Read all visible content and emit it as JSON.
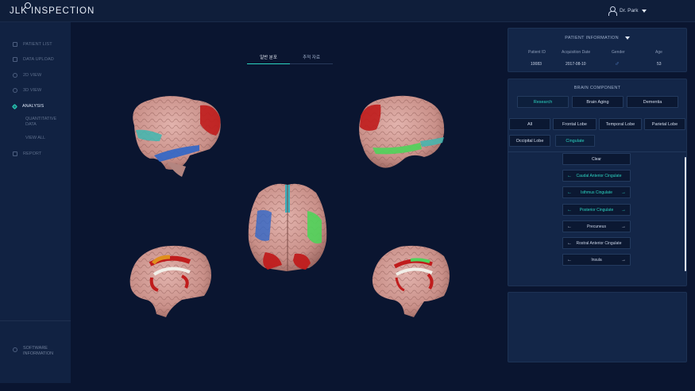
{
  "app": {
    "title": "JLK INSPECTION",
    "user": "Dr. Park"
  },
  "sidebar": {
    "items": [
      {
        "label": "PATIENT LIST"
      },
      {
        "label": "DATA UPLOAD"
      },
      {
        "label": "2D VIEW"
      },
      {
        "label": "3D VIEW"
      },
      {
        "label": "ANALYSIS"
      },
      {
        "label": "QUANTITATIVE"
      },
      {
        "label": "DATA"
      },
      {
        "label": "VIEW ALL"
      },
      {
        "label": "REPORT"
      }
    ],
    "software_line1": "SOFTWARE",
    "software_line2": "INFORMATION"
  },
  "viewer": {
    "tabs": [
      {
        "label": "일반 분포"
      },
      {
        "label": "추적 자료"
      }
    ]
  },
  "patient_info": {
    "title": "PATIENT INFORMATION",
    "headers": {
      "id": "Patient ID",
      "date": "Acquisition Date",
      "gender": "Gender",
      "age": "Age"
    },
    "values": {
      "id": "10083",
      "date": "2017-08-10",
      "gender": "♂",
      "age": "53"
    }
  },
  "brain_component": {
    "title": "BRAIN COMPONENT",
    "categories": [
      {
        "label": "Research"
      },
      {
        "label": "Brain Aging"
      },
      {
        "label": "Dementia"
      }
    ],
    "lobes": [
      {
        "label": "All"
      },
      {
        "label": "Frontal Lobe"
      },
      {
        "label": "Temporal Lobe"
      },
      {
        "label": "Parietal Lobe"
      },
      {
        "label": "Occipital Lobe"
      },
      {
        "label": "Cingulate"
      }
    ],
    "clear_label": "Clear",
    "regions": [
      {
        "label": "Caudal Anterior Cingulate"
      },
      {
        "label": "Isthmus Cingulate"
      },
      {
        "label": "Posterior Cingulate"
      },
      {
        "label": "Precuneus"
      },
      {
        "label": "Rostral Anterior Cingulate"
      },
      {
        "label": "Insula"
      }
    ]
  },
  "colors": {
    "accent": "#2bd3c0",
    "background": "#0a1530",
    "panel": "#132648"
  }
}
